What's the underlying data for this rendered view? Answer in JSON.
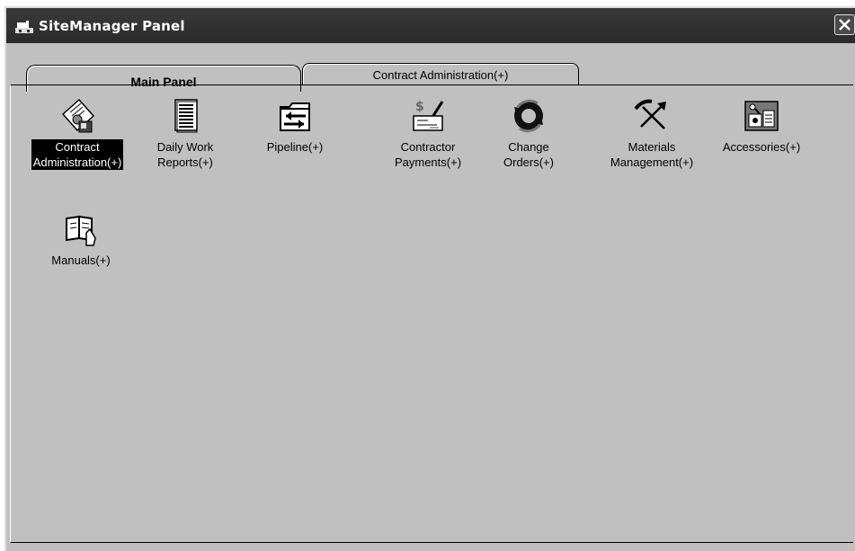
{
  "window": {
    "title": "SiteManager Panel",
    "title_icon": "sitemanager-app-icon",
    "close_icon": "close-icon"
  },
  "tabs": [
    {
      "label": "Main Panel",
      "active": true
    },
    {
      "label": "Contract Administration(+)",
      "active": false
    }
  ],
  "icons": [
    {
      "label": "Contract\nAdministration(+)",
      "icon": "contract-document-icon",
      "selected": true
    },
    {
      "label": "Daily Work\nReports(+)",
      "icon": "report-page-icon",
      "selected": false
    },
    {
      "label": "Pipeline(+)",
      "icon": "pipeline-folder-icon",
      "selected": false
    },
    {
      "label": "Contractor\nPayments(+)",
      "icon": "payment-check-icon",
      "selected": false
    },
    {
      "label": "Change\nOrders(+)",
      "icon": "change-orders-icon",
      "selected": false
    },
    {
      "label": "Materials\nManagement(+)",
      "icon": "pickaxe-shovel-icon",
      "selected": false
    },
    {
      "label": "Accessories(+)",
      "icon": "accessories-icon",
      "selected": false
    },
    {
      "label": "Manuals(+)",
      "icon": "manual-book-icon",
      "selected": false
    }
  ]
}
